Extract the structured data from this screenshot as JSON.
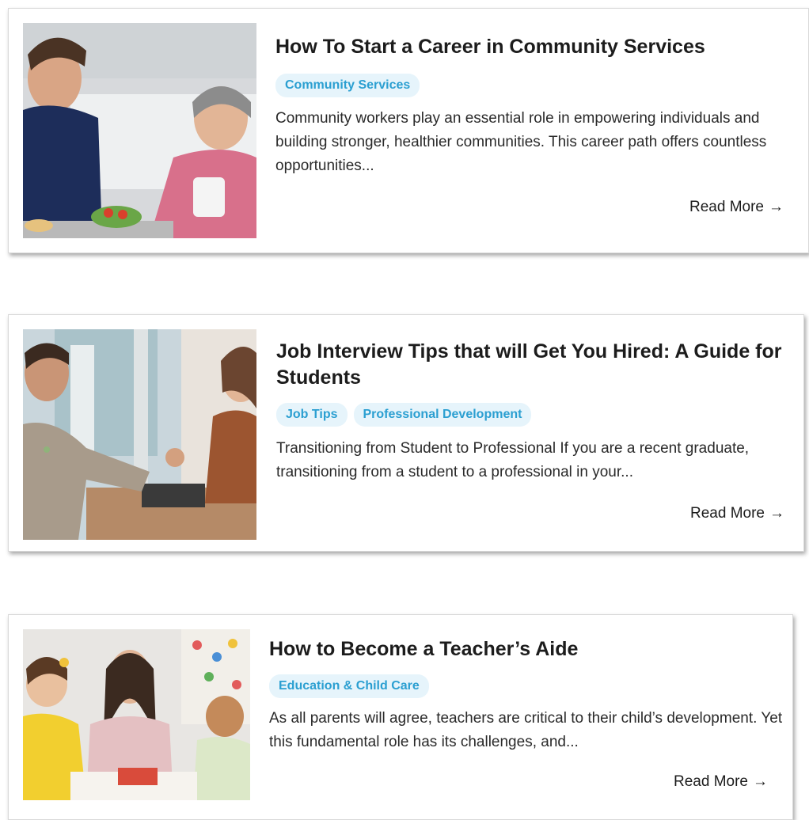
{
  "posts": [
    {
      "title": "How To Start a Career in Community Services",
      "tags": [
        "Community Services"
      ],
      "excerpt": "Community workers play an essential role in empowering individuals and building stronger, healthier communities. This career path offers countless opportunities...",
      "read_more": "Read More",
      "arrow": "→"
    },
    {
      "title": "Job Interview Tips that will Get You Hired: A Guide for Students",
      "tags": [
        "Job Tips",
        "Professional Development"
      ],
      "excerpt": "Transitioning from Student to Professional If you are a recent graduate, transitioning from a student to a professional in your...",
      "read_more": "Read More",
      "arrow": "→"
    },
    {
      "title": "How to Become a Teacher’s Aide",
      "tags": [
        "Education & Child Care"
      ],
      "excerpt": "As all parents will agree, teachers are critical to their child’s development. Yet this fundamental role has its challenges, and...",
      "read_more": "Read More",
      "arrow": "→"
    }
  ],
  "colors": {
    "tag_bg": "#e6f4fb",
    "tag_text": "#2b9fd1",
    "title_text": "#1c1c1c"
  }
}
